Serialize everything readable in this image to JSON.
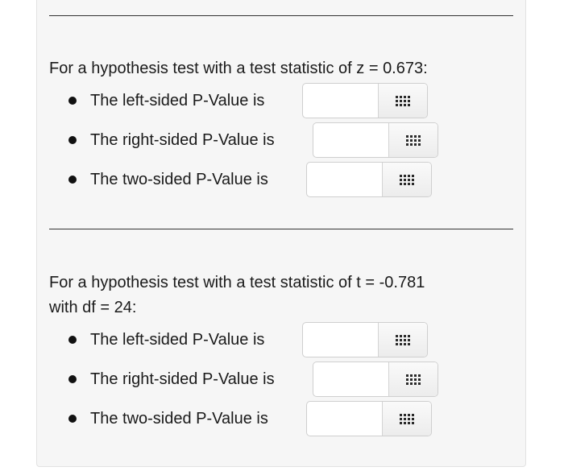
{
  "questions": [
    {
      "prompt": "For a hypothesis test with a test statistic of z = 0.673:",
      "items": [
        {
          "label": "The left-sided P-Value is",
          "value": "",
          "icon": "grid-icon"
        },
        {
          "label": "The right-sided P-Value is",
          "value": "",
          "icon": "grid-icon"
        },
        {
          "label": "The two-sided P-Value is",
          "value": "",
          "icon": "grid-icon"
        }
      ]
    },
    {
      "prompt_line1": "For a hypothesis test with a test statistic of t = -0.781",
      "prompt_line2": "with df = 24:",
      "items": [
        {
          "label": "The left-sided P-Value is",
          "value": "",
          "icon": "grid-icon"
        },
        {
          "label": "The right-sided P-Value is",
          "value": "",
          "icon": "grid-icon"
        },
        {
          "label": "The two-sided P-Value is",
          "value": "",
          "icon": "grid-icon"
        }
      ]
    }
  ]
}
